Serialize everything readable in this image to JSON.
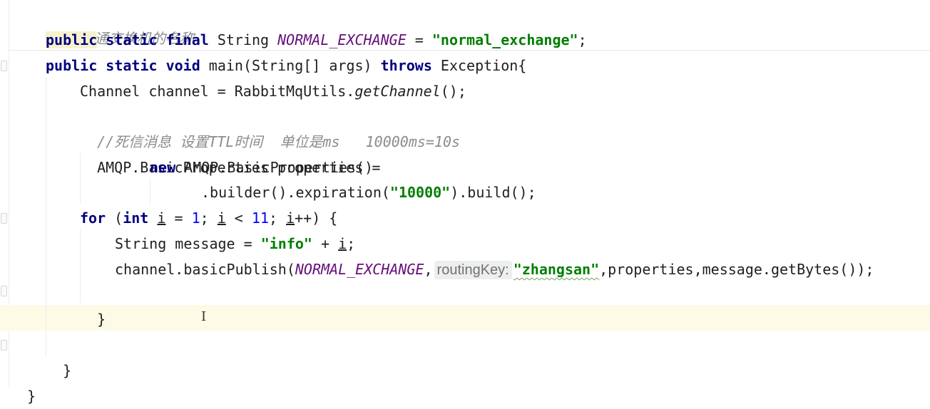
{
  "editor": {
    "comment_exchange": "//普通交换机的名称",
    "decl": {
      "public": "public",
      "static_final": " static final ",
      "type": "String ",
      "const": "NORMAL_EXCHANGE",
      "eq": " = ",
      "value": "\"normal_exchange\"",
      "semi": ";"
    },
    "main": {
      "mods": "public static void ",
      "name": "main(String[] args) ",
      "throws": "throws",
      "rest": " Exception{"
    },
    "channel": {
      "left": "Channel channel = RabbitMqUtils.",
      "call": "getChannel",
      "end": "();"
    },
    "comment_ttl": "//死信消息 设置TTL时间  单位是ms   10000ms=10s",
    "props": {
      "line1": "AMQP.BasicProperties properties =",
      "new_kw": "new",
      "line2": " AMQP.BasicProperties()",
      "line3a": ".builder().expiration(",
      "expiration": "\"10000\"",
      "line3b": ").build();"
    },
    "loop": {
      "for": "for",
      "p1": " (",
      "int": "int",
      "p2": " ",
      "i1": "i",
      "p3": " = ",
      "one": "1",
      "p4": "; ",
      "i2": "i",
      "p5": " < ",
      "eleven": "11",
      "p6": "; ",
      "i3": "i",
      "p7": "++) {"
    },
    "message": {
      "left": "String message = ",
      "str": "\"info\"",
      "plus": " + ",
      "i": "i",
      "semi": ";"
    },
    "publish": {
      "left": "channel.basicPublish(",
      "const": "NORMAL_EXCHANGE",
      "comma": ",",
      "hint": "routingKey:",
      "key": "\"zhangsan\"",
      "rest": ",properties,message.getBytes());"
    },
    "close_for": "}",
    "close_main": "}",
    "close_class": "}"
  }
}
